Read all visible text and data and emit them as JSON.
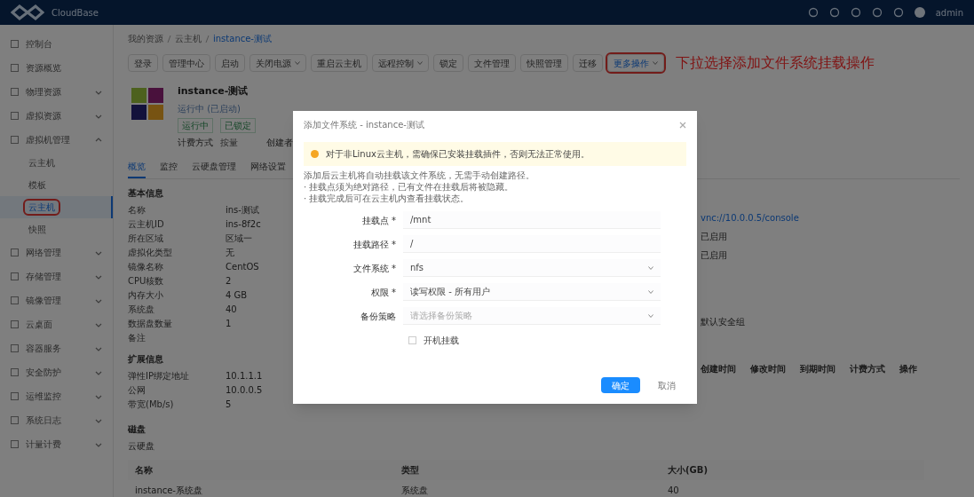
{
  "topbar": {
    "brand": "CloudBase",
    "user": "admin"
  },
  "sidebar": {
    "items": [
      {
        "label": "控制台"
      },
      {
        "label": "资源概览"
      },
      {
        "label": "物理资源",
        "expanded": false
      },
      {
        "label": "虚拟资源",
        "expanded": false
      },
      {
        "label": "虚拟机管理",
        "expanded": true,
        "children": [
          {
            "label": "云主机",
            "selected": false,
            "highlighted": false
          },
          {
            "label": "模板",
            "selected": false,
            "highlighted": false
          },
          {
            "label": "云主机",
            "selected": true,
            "highlighted": true
          },
          {
            "label": "快照",
            "selected": false,
            "highlighted": false
          }
        ]
      },
      {
        "label": "网络管理",
        "expanded": false
      },
      {
        "label": "存储管理",
        "expanded": false
      },
      {
        "label": "镜像管理",
        "expanded": false
      },
      {
        "label": "云桌面",
        "expanded": false
      },
      {
        "label": "容器服务",
        "expanded": false
      },
      {
        "label": "安全防护",
        "expanded": false
      },
      {
        "label": "运维监控",
        "expanded": false
      },
      {
        "label": "系统日志",
        "expanded": false
      },
      {
        "label": "计量计费",
        "expanded": false
      }
    ]
  },
  "breadcrumb": [
    "我的资源",
    "云主机",
    "instance-测试"
  ],
  "toolbar": [
    {
      "label": "登录",
      "dropdown": false,
      "highlighted": false
    },
    {
      "label": "管理中心",
      "dropdown": false,
      "highlighted": false
    },
    {
      "label": "启动",
      "dropdown": false,
      "highlighted": false
    },
    {
      "label": "关闭电源",
      "dropdown": true,
      "highlighted": false
    },
    {
      "label": "重启云主机",
      "dropdown": false,
      "highlighted": false
    },
    {
      "label": "远程控制",
      "dropdown": true,
      "highlighted": false
    },
    {
      "label": "锁定",
      "dropdown": false,
      "highlighted": false
    },
    {
      "label": "文件管理",
      "dropdown": false,
      "highlighted": false
    },
    {
      "label": "快照管理",
      "dropdown": false,
      "highlighted": false
    },
    {
      "label": "迁移",
      "dropdown": false,
      "highlighted": false
    },
    {
      "label": "更多操作",
      "dropdown": true,
      "highlighted": true
    }
  ],
  "annotation": "下拉选择添加文件系统挂载操作",
  "instance": {
    "name": "instance-测试",
    "subtitle": "运行中 (已启动)",
    "tags": [
      "运行中",
      "已锁定"
    ],
    "billing_label": "计费方式",
    "billing_value": "按量",
    "owner": "创建者"
  },
  "tabs": [
    {
      "label": "概览",
      "selected": true
    },
    {
      "label": "监控",
      "selected": false
    },
    {
      "label": "云硬盘管理",
      "selected": false
    },
    {
      "label": "网络设置",
      "selected": false
    }
  ],
  "basic": {
    "title": "基本信息",
    "rows": [
      {
        "key": "名称",
        "value": "ins-测试"
      },
      {
        "key": "云主机ID",
        "value": "ins-8f2c"
      },
      {
        "key": "所在区域",
        "value": "区域一"
      },
      {
        "key": "虚拟化类型",
        "value": "无"
      },
      {
        "key": "镜像名称",
        "value": "CentOS"
      },
      {
        "key": "CPU核数",
        "value": "2"
      },
      {
        "key": "内存大小",
        "value": "4 GB"
      },
      {
        "key": "系统盘",
        "value": "40"
      },
      {
        "key": "数据盘数量",
        "value": "1"
      },
      {
        "key": "备注"
      }
    ]
  },
  "right_info": {
    "link": "vnc://10.0.0.5/console",
    "values": [
      "已启用",
      "已启用",
      "默认安全组"
    ]
  },
  "right_table_headers": [
    "创建时间",
    "修改时间",
    "到期时间",
    "计费方式",
    "操作"
  ],
  "extra": {
    "title": "扩展信息",
    "rows": [
      {
        "key": "弹性IP绑定地址",
        "value": "10.1.1.1"
      },
      {
        "key": "公网",
        "value": "10.0.0.5"
      },
      {
        "key": "带宽(Mb/s)",
        "value": "5"
      }
    ]
  },
  "disks": {
    "title": "磁盘",
    "subtitle": "云硬盘",
    "columns": [
      "名称",
      "类型",
      "大小(GB)"
    ],
    "rows": [
      [
        "instance-系统盘",
        "系统盘",
        "40"
      ]
    ]
  },
  "dialog": {
    "title": "添加文件系统 - instance-测试",
    "warning": "对于非Linux云主机，需确保已安装挂载插件，否则无法正常使用。",
    "notes": [
      "添加后云主机将自动挂载该文件系统，无需手动创建路径。",
      "· 挂载点须为绝对路径，已有文件在挂载后将被隐藏。",
      "· 挂载完成后可在云主机内查看挂载状态。"
    ],
    "fields": [
      {
        "kind": "input",
        "label": "挂载点 *",
        "value": "/mnt"
      },
      {
        "kind": "input",
        "label": "挂载路径 *",
        "value": "/"
      },
      {
        "kind": "select",
        "label": "文件系统 *",
        "value": "nfs"
      },
      {
        "kind": "select",
        "label": "权限 *",
        "value": "读写权限 - 所有用户"
      },
      {
        "kind": "select",
        "label": "备份策略",
        "placeholder": "请选择备份策略"
      }
    ],
    "checkbox": {
      "label": "开机挂载",
      "checked": false
    },
    "buttons": [
      {
        "label": "确定",
        "primary": true
      },
      {
        "label": "取消",
        "primary": false
      }
    ]
  }
}
